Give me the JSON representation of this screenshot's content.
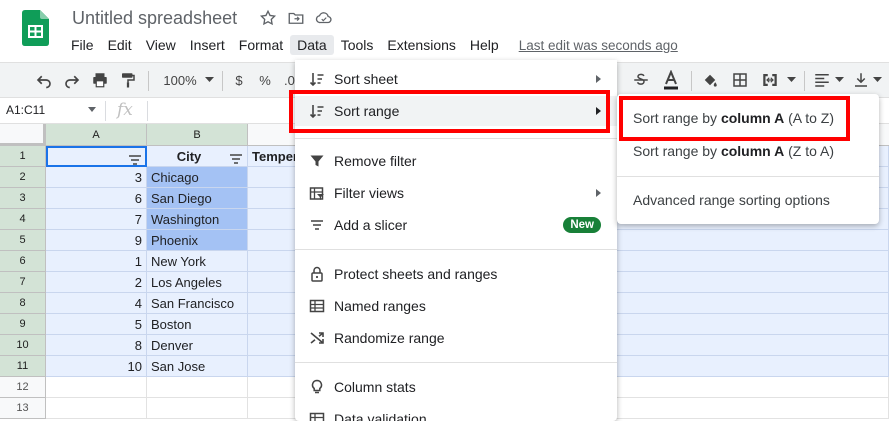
{
  "doc": {
    "title": "Untitled spreadsheet",
    "last_edit": "Last edit was seconds ago"
  },
  "menubar": [
    "File",
    "Edit",
    "View",
    "Insert",
    "Format",
    "Data",
    "Tools",
    "Extensions",
    "Help"
  ],
  "toolbar": {
    "zoom": "100%",
    "currency": "$",
    "percent": "%",
    "decimal": ".0"
  },
  "formula_bar": {
    "name_box": "A1:C11",
    "fx": "fx"
  },
  "grid": {
    "columns": [
      "A",
      "B"
    ],
    "header_row": {
      "b": "City",
      "c": "Temper"
    },
    "rows": [
      {
        "n": "1"
      },
      {
        "n": "2",
        "a": "3",
        "b": "Chicago"
      },
      {
        "n": "3",
        "a": "6",
        "b": "San Diego"
      },
      {
        "n": "4",
        "a": "7",
        "b": "Washington"
      },
      {
        "n": "5",
        "a": "9",
        "b": "Phoenix"
      },
      {
        "n": "6",
        "a": "1",
        "b": "New York"
      },
      {
        "n": "7",
        "a": "2",
        "b": "Los Angeles"
      },
      {
        "n": "8",
        "a": "4",
        "b": "San Francisco"
      },
      {
        "n": "9",
        "a": "5",
        "b": "Boston"
      },
      {
        "n": "10",
        "a": "8",
        "b": "Denver"
      },
      {
        "n": "11",
        "a": "10",
        "b": "San Jose"
      },
      {
        "n": "12"
      },
      {
        "n": "13"
      }
    ]
  },
  "data_menu": {
    "sort_sheet": "Sort sheet",
    "sort_range": "Sort range",
    "remove_filter": "Remove filter",
    "filter_views": "Filter views",
    "add_slicer": "Add a slicer",
    "new_badge": "New",
    "protect": "Protect sheets and ranges",
    "named_ranges": "Named ranges",
    "randomize": "Randomize range",
    "column_stats": "Column stats",
    "data_validation": "Data validation"
  },
  "submenu": {
    "az_prefix": "Sort range by ",
    "az_bold": "column A",
    "az_suffix": " (A to Z)",
    "za_prefix": "Sort range by ",
    "za_bold": "column A",
    "za_suffix": " (Z to A)",
    "advanced": "Advanced range sorting options"
  },
  "colors": {
    "highlight": "#ff0000",
    "selection": "#e8f0fe",
    "selection_strong": "#a4c2f4",
    "header_selected": "#d3e3d6",
    "badge": "#188038"
  }
}
